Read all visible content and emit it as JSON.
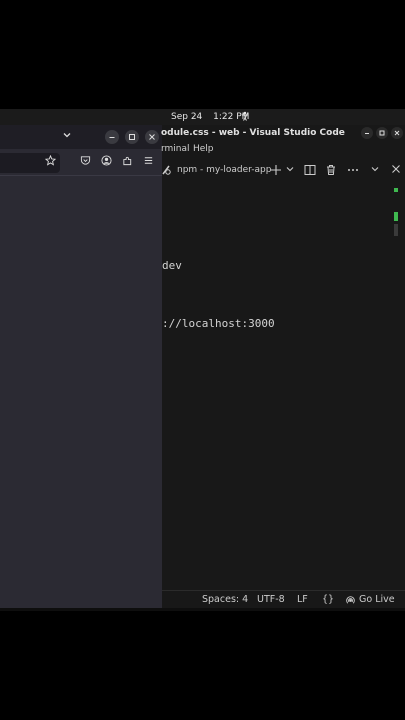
{
  "topbar": {
    "date": "Sep 24",
    "time": "1:22 PM",
    "status_icon": "accessibility-icon"
  },
  "browser": {
    "controls": {
      "dropdown": "⌄",
      "minimize": "–",
      "maximize": "□",
      "close": "×"
    },
    "toolbar_icons": [
      "star-icon",
      "pocket-icon",
      "account-icon",
      "extensions-icon",
      "menu-icon"
    ]
  },
  "vscode": {
    "title": "odule.css - web - Visual Studio Code",
    "menu": {
      "terminal": "rminal",
      "help": "Help"
    },
    "panel": {
      "terminal_name": "npm - my-loader-app"
    },
    "terminal_lines": [
      "dev",
      "://localhost:3000"
    ],
    "status": {
      "spaces": "Spaces: 4",
      "encoding": "UTF-8",
      "eol": "LF",
      "braces": "{}",
      "golive": "Go Live"
    }
  },
  "colors": {
    "accent_green": "#3fb950",
    "terminal_bg": "#181818",
    "browser_bg": "#2b2a33"
  }
}
